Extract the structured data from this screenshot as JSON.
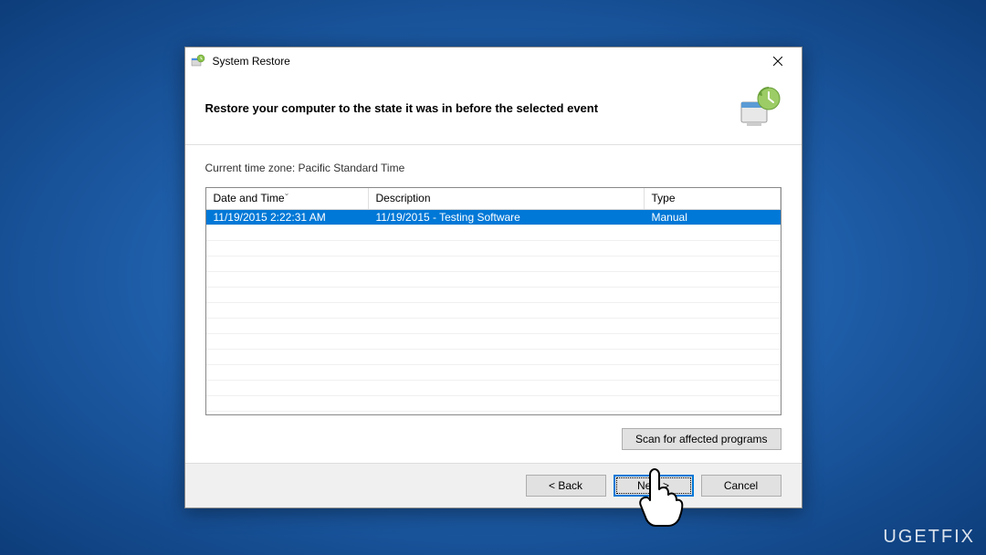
{
  "titlebar": {
    "title": "System Restore"
  },
  "header": {
    "heading": "Restore your computer to the state it was in before the selected event"
  },
  "content": {
    "timezone_label": "Current time zone: Pacific Standard Time"
  },
  "grid": {
    "columns": {
      "date": "Date and Time",
      "description": "Description",
      "type": "Type"
    },
    "rows": [
      {
        "date": "11/19/2015 2:22:31 AM",
        "description": "11/19/2015 - Testing Software",
        "type": "Manual"
      }
    ]
  },
  "actions": {
    "scan": "Scan for affected programs",
    "back": "< Back",
    "next": "Next >",
    "cancel": "Cancel"
  },
  "watermark": "UGETFIX"
}
